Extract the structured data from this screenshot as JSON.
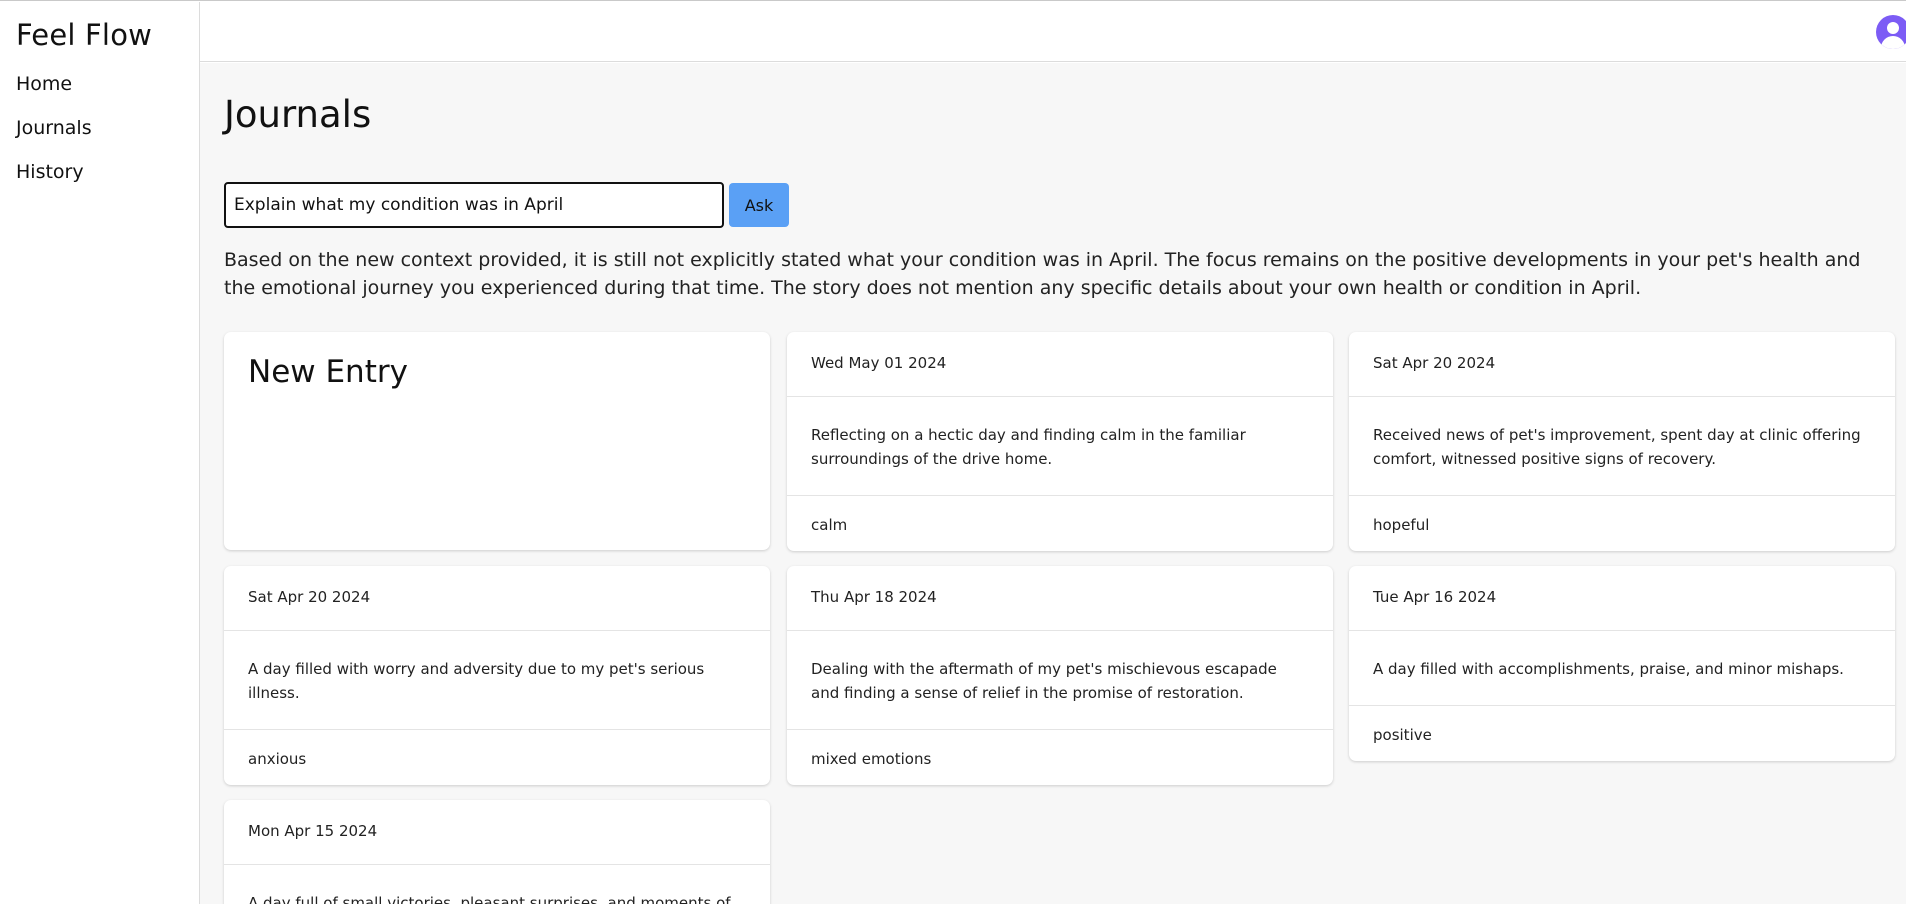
{
  "app": {
    "brand": "Feel Flow"
  },
  "sidebar": {
    "items": [
      {
        "label": "Home"
      },
      {
        "label": "Journals"
      },
      {
        "label": "History"
      }
    ]
  },
  "page": {
    "title": "Journals"
  },
  "ask": {
    "input_value": "Explain what my condition was in April",
    "button_label": "Ask",
    "answer": "Based on the new context provided, it is still not explicitly stated what your condition was in April. The focus remains on the positive developments in your pet's health and the emotional journey you experienced during that time. The story does not mention any specific details about your own health or condition in April."
  },
  "new_entry": {
    "label": "New Entry"
  },
  "entries": [
    {
      "date": "Wed May 01 2024",
      "summary": "Reflecting on a hectic day and finding calm in the familiar surroundings of the drive home.",
      "mood": "calm"
    },
    {
      "date": "Sat Apr 20 2024",
      "summary": "Received news of pet's improvement, spent day at clinic offering comfort, witnessed positive signs of recovery.",
      "mood": "hopeful"
    },
    {
      "date": "Sat Apr 20 2024",
      "summary": "A day filled with worry and adversity due to my pet's serious illness.",
      "mood": "anxious"
    },
    {
      "date": "Thu Apr 18 2024",
      "summary": "Dealing with the aftermath of my pet's mischievous escapade and finding a sense of relief in the promise of restoration.",
      "mood": "mixed emotions"
    },
    {
      "date": "Tue Apr 16 2024",
      "summary": "A day filled with accomplishments, praise, and minor mishaps.",
      "mood": "positive"
    },
    {
      "date": "Mon Apr 15 2024",
      "summary": "A day full of small victories, pleasant surprises, and moments of",
      "mood": ""
    }
  ],
  "colors": {
    "accent": "#5aa0f5",
    "avatar": "#7c5cf5",
    "main_bg": "#f7f7f7"
  },
  "icons": {
    "avatar": "user-avatar-icon"
  }
}
